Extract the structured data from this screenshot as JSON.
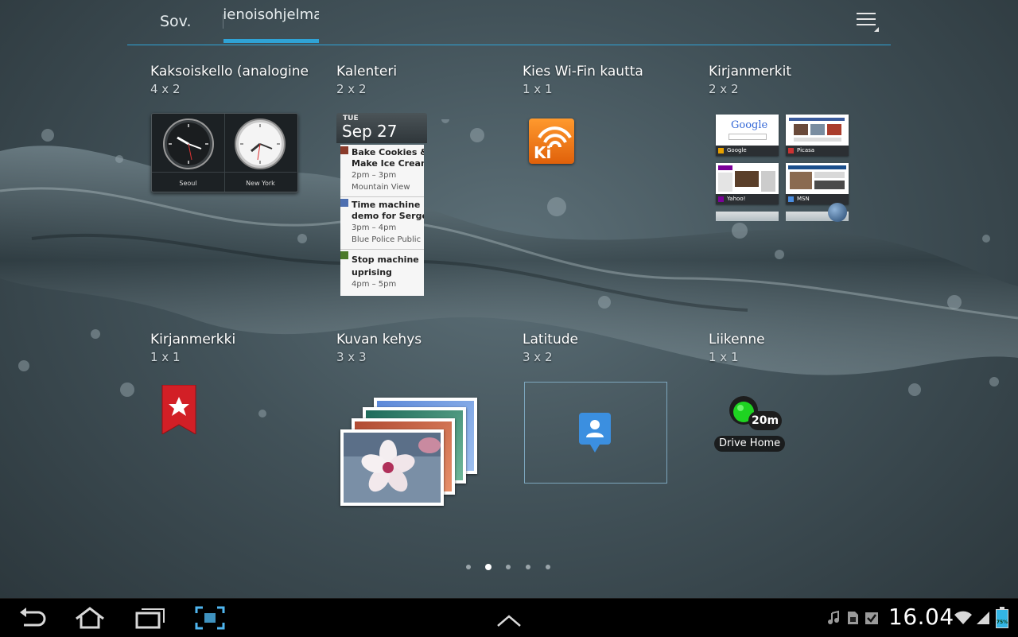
{
  "tabs": {
    "apps": "Sov.",
    "widgets": "Pienoisohjelmat",
    "active": "widgets"
  },
  "widgets": [
    {
      "name": "Kaksoiskello (analoginen)",
      "size": "4 x 2"
    },
    {
      "name": "Kalenteri",
      "size": "2 x 2"
    },
    {
      "name": "Kies Wi-Fin kautta",
      "size": "1 x 1"
    },
    {
      "name": "Kirjanmerkit",
      "size": "2 x 2"
    },
    {
      "name": "Kirjanmerkki",
      "size": "1 x 1"
    },
    {
      "name": "Kuvan kehys",
      "size": "3 x 3"
    },
    {
      "name": "Latitude",
      "size": "3 x 2"
    },
    {
      "name": "Liikenne",
      "size": "1 x 1"
    }
  ],
  "dual_clock": {
    "city1": "Seoul",
    "city2": "New York"
  },
  "calendar": {
    "day": "TUE",
    "date": "Sep 27",
    "events": [
      {
        "title1": "Bake Cookies &",
        "title2": "Make Ice Cream",
        "time": "2pm – 3pm",
        "place": "Mountain View",
        "color": "#8a3b2b"
      },
      {
        "title1": "Time machine",
        "title2": "demo for Sergey",
        "time": "3pm – 4pm",
        "place": "Blue Police Public",
        "color": "#4d6fb0"
      },
      {
        "title1": "Stop machine",
        "title2": "uprising",
        "time": "4pm – 5pm",
        "place": "",
        "color": "#4c7a2a"
      }
    ]
  },
  "kies": {
    "logo_text": "Ki"
  },
  "bookmarks": [
    {
      "label": "Google",
      "page_logo": "Google"
    },
    {
      "label": "Picasa"
    },
    {
      "label": "Yahoo!"
    },
    {
      "label": "MSN"
    }
  ],
  "traffic": {
    "time": "20m",
    "destination": "Drive Home"
  },
  "page_dots": {
    "count": 5,
    "active_index": 1
  },
  "system_bar": {
    "time": "16.04",
    "battery": "75%",
    "icons": [
      "back-icon",
      "home-icon",
      "recent-apps-icon",
      "screenshot-icon",
      "up-arrow-icon",
      "music-icon",
      "sd-card-icon",
      "task-icon",
      "wifi-icon",
      "signal-icon",
      "battery-icon"
    ]
  },
  "colors": {
    "accent": "#2fa3d6",
    "kies": "#f07a16",
    "bookmark_red": "#d21f26",
    "latitude_blue": "#3b8fe0",
    "traffic_green": "#1ed321"
  }
}
